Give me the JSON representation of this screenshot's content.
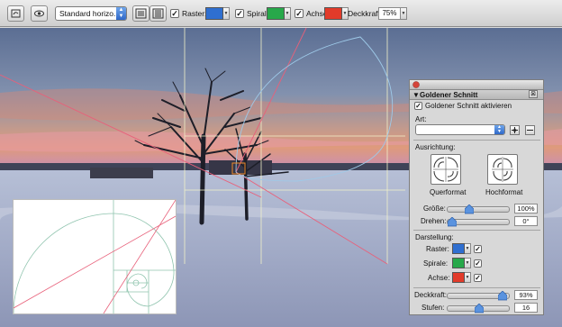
{
  "toolbar": {
    "crop_icon": "crop-icon",
    "view_icon": "eye-icon",
    "preset_select": "Standard horizo...",
    "raster_label": "Raster:",
    "raster_checked": true,
    "raster_color": "#2f6fd0",
    "spirale_label": "Spirale:",
    "spirale_checked": true,
    "spirale_color": "#27a84a",
    "achse_label": "Achse:",
    "achse_checked": true,
    "achse_color": "#e23b2a",
    "deckkraft_label": "Deckkraft:",
    "deckkraft_value": "75%"
  },
  "panel": {
    "title": "Goldener Schnitt",
    "activate_label": "Goldener Schnitt aktivieren",
    "activate_checked": true,
    "art_label": "Art:",
    "art_value": "",
    "ausrichtung_label": "Ausrichtung:",
    "querformat_label": "Querformat",
    "hochformat_label": "Hochformat",
    "groesse_label": "Größe:",
    "groesse_value": "100%",
    "groesse_level": 0.32,
    "drehen_label": "Drehen:",
    "drehen_value": "0°",
    "drehen_level": 0.0,
    "darstellung_label": "Darstellung:",
    "raster_label": "Raster:",
    "raster_color": "#2f6fd0",
    "raster_checked": true,
    "spirale_label": "Spirale:",
    "spirale_color": "#27a84a",
    "spirale_checked": true,
    "achse_label": "Achse:",
    "achse_color": "#e23b2a",
    "achse_checked": true,
    "deckkraft_label": "Deckkraft:",
    "deckkraft_value": "93%",
    "deckkraft_level": 0.93,
    "stufen_label": "Stufen:",
    "stufen_value": "16",
    "stufen_level": 0.5
  },
  "colors": {
    "grid_line": "#f2f2c8",
    "axis_line": "#e8607a",
    "spiral_line": "#9ec9e8",
    "orange_rect": "#f08a2a"
  }
}
